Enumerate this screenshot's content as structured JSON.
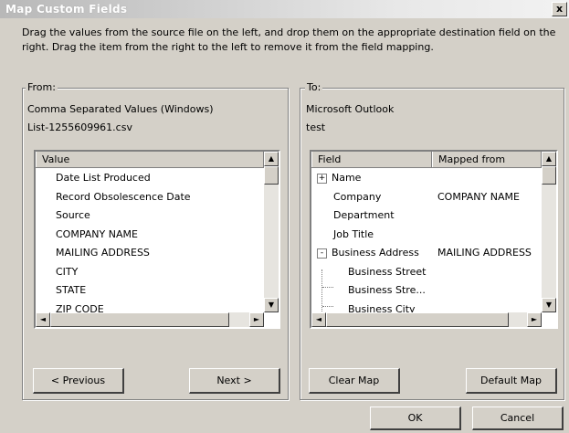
{
  "window": {
    "title": "Map Custom Fields",
    "close_glyph": "x"
  },
  "instructions": "Drag the values from the source file on the left, and drop them on the appropriate destination field on the right.  Drag the item from the right to the left to remove it from the field mapping.",
  "from": {
    "group_label": "From:",
    "source_type": "Comma Separated Values (Windows)",
    "file_name": "List-1255609961.csv",
    "column_header": "Value",
    "items": [
      "Date List Produced",
      "Record Obsolescence Date",
      "Source",
      "COMPANY NAME",
      "MAILING ADDRESS",
      "CITY",
      "STATE",
      "ZIP CODE"
    ],
    "previous_label": "< Previous",
    "next_label": "Next >"
  },
  "to": {
    "group_label": "To:",
    "target_app": "Microsoft Outlook",
    "folder_name": "test",
    "col_field": "Field",
    "col_mapped": "Mapped from",
    "rows": [
      {
        "field": "Name",
        "mapped": "",
        "expander": "+"
      },
      {
        "field": "Company",
        "mapped": "COMPANY NAME"
      },
      {
        "field": "Department",
        "mapped": ""
      },
      {
        "field": "Job Title",
        "mapped": ""
      },
      {
        "field": "Business Address",
        "mapped": "MAILING ADDRESS",
        "expander": "-"
      },
      {
        "field": "Business Street",
        "mapped": ""
      },
      {
        "field": "Business Stre...",
        "mapped": ""
      },
      {
        "field": "Business City",
        "mapped": ""
      }
    ],
    "clear_label": "Clear Map",
    "default_label": "Default Map"
  },
  "footer": {
    "ok_label": "OK",
    "cancel_label": "Cancel"
  },
  "scroll": {
    "up": "▲",
    "down": "▼",
    "left": "◄",
    "right": "►"
  }
}
